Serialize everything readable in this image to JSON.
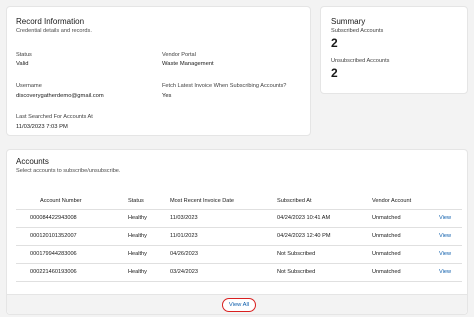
{
  "record": {
    "title": "Record Information",
    "subtitle": "Credential details and records.",
    "fields": [
      {
        "label": "Status",
        "value": "Valid"
      },
      {
        "label": "Vendor Portal",
        "value": "Waste Management"
      },
      {
        "label": "Username",
        "value": "discoverygatherdemo@gmail.com"
      },
      {
        "label": "Fetch Latest Invoice When Subscribing Accounts?",
        "value": "Yes"
      },
      {
        "label": "Last Searched For Accounts At",
        "value": "11/03/2023 7:03 PM"
      }
    ]
  },
  "summary": {
    "title": "Summary",
    "subscribed_label": "Subscribed Accounts",
    "subscribed_count": "2",
    "unsubscribed_label": "Unsubscribed Accounts",
    "unsubscribed_count": "2"
  },
  "accounts": {
    "title": "Accounts",
    "subtitle": "Select accounts to subscribe/unsubscribe.",
    "columns": [
      "Account Number",
      "Status",
      "Most Recent Invoice Date",
      "Subscribed At",
      "Vendor Account",
      ""
    ],
    "rows": [
      {
        "account": "000084422943008",
        "status": "Healthy",
        "invoice_date": "11/03/2023",
        "subscribed_at": "04/24/2023 10:41 AM",
        "vendor_account": "Unmatched",
        "action": "View"
      },
      {
        "account": "000120101352007",
        "status": "Healthy",
        "invoice_date": "11/01/2023",
        "subscribed_at": "04/24/2023 12:40 PM",
        "vendor_account": "Unmatched",
        "action": "View"
      },
      {
        "account": "000179944283006",
        "status": "Healthy",
        "invoice_date": "04/26/2023",
        "subscribed_at": "Not Subscribed",
        "vendor_account": "Unmatched",
        "action": "View"
      },
      {
        "account": "000221460193006",
        "status": "Healthy",
        "invoice_date": "03/24/2023",
        "subscribed_at": "Not Subscribed",
        "vendor_account": "Unmatched",
        "action": "View"
      }
    ],
    "view_all_label": "View All"
  },
  "colors": {
    "link": "#0b5cab",
    "highlight_ring": "#d92020",
    "background": "#f3f3f3"
  }
}
